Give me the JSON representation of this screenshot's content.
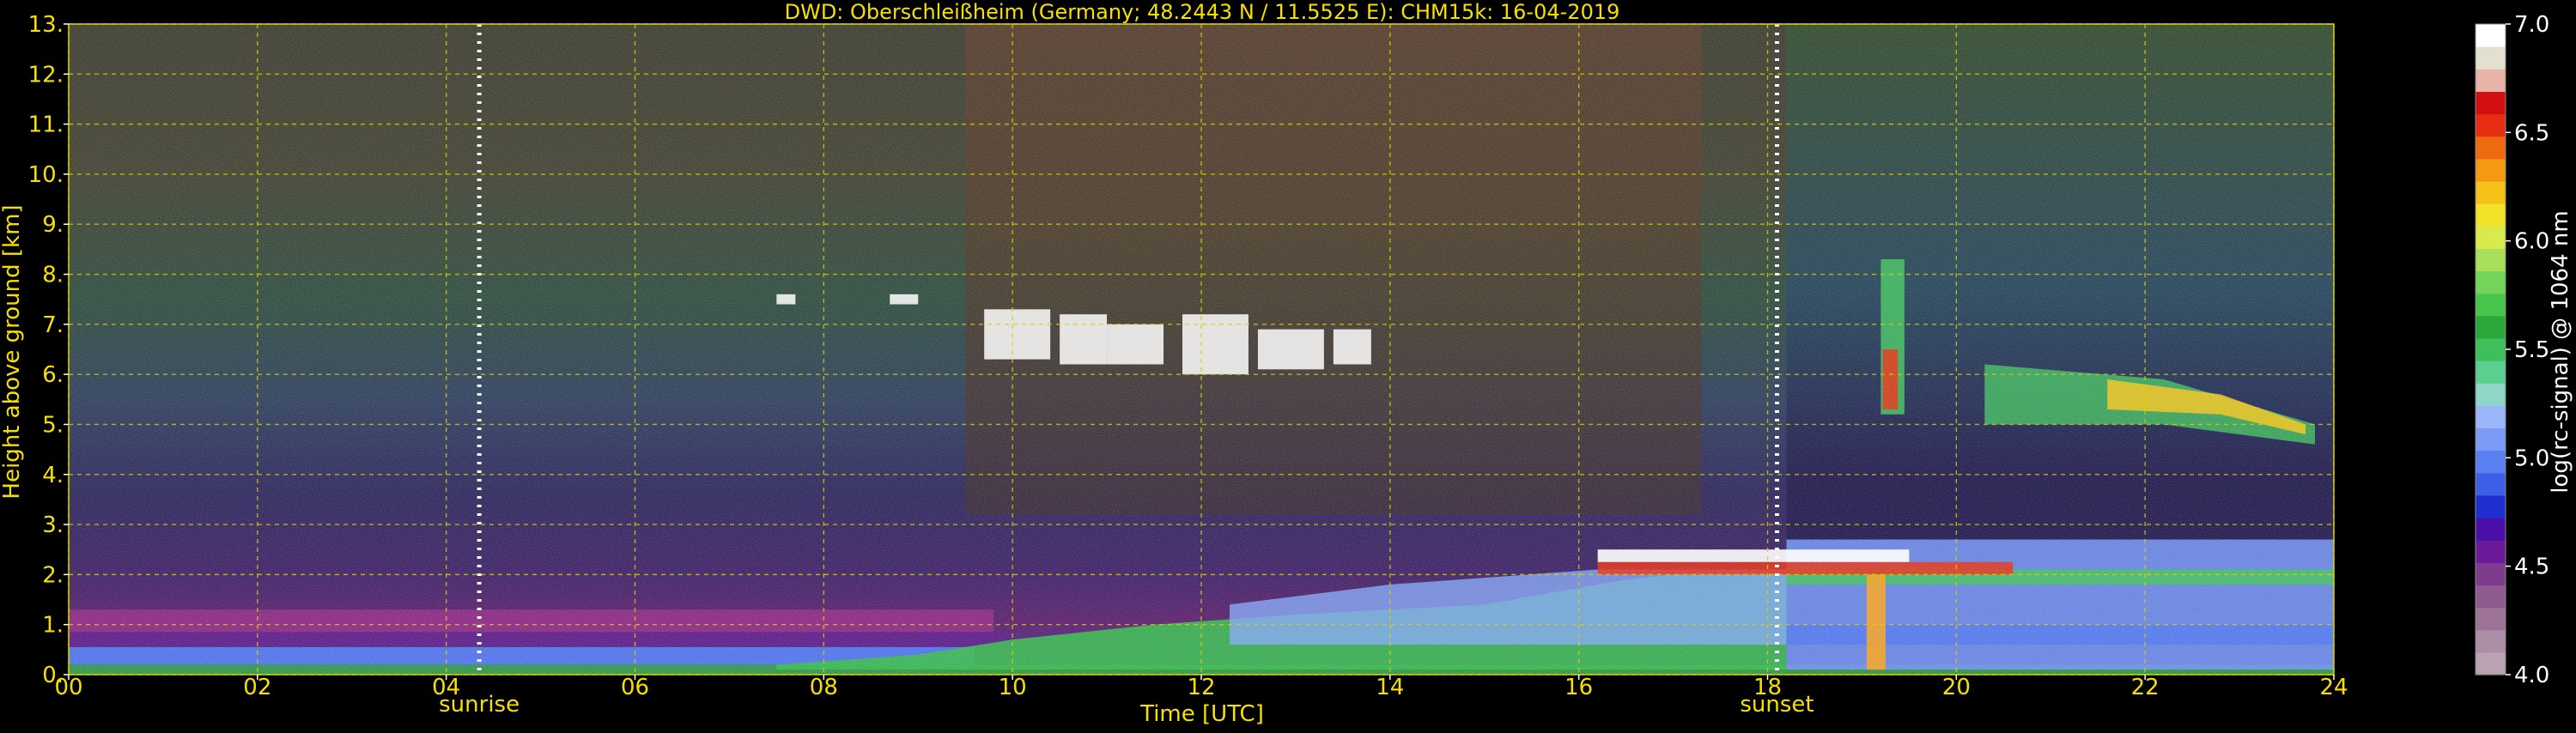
{
  "chart_data": {
    "type": "heatmap",
    "title": "DWD: Oberschleißheim (Germany; 48.2443 N / 11.5525 E):    CHM15k: 16-04-2019",
    "xlabel": "Time [UTC]",
    "ylabel": "Height above ground [km]",
    "xlim": [
      0,
      24
    ],
    "ylim": [
      0,
      13
    ],
    "x_ticks": [
      "00",
      "02",
      "04",
      "06",
      "08",
      "10",
      "12",
      "14",
      "16",
      "18",
      "20",
      "22",
      "24"
    ],
    "y_ticks": [
      "0.",
      "1.",
      "2.",
      "3.",
      "4.",
      "5.",
      "6.",
      "7.",
      "8.",
      "9.",
      "10.",
      "11.",
      "12.",
      "13."
    ],
    "grid": true,
    "markers": [
      {
        "label": "sunrise",
        "time": 4.35
      },
      {
        "label": "sunset",
        "time": 18.1
      }
    ],
    "colorbar": {
      "label": "log(rc-signal) @ 1064 nm",
      "range": [
        4.0,
        7.0
      ],
      "ticks": [
        "4.0",
        "4.5",
        "5.0",
        "5.5",
        "6.0",
        "6.5",
        "7.0"
      ],
      "levels": [
        "#b9a3b3",
        "#ac8fa6",
        "#9d7498",
        "#8f5a90",
        "#7e3c8e",
        "#6a1a98",
        "#4a0fa8",
        "#1e2fd0",
        "#3b5fe6",
        "#5a7ff0",
        "#7b9bf6",
        "#9cb6fb",
        "#8fd6c8",
        "#5bcf8e",
        "#3fbf5c",
        "#2aa83a",
        "#49c44c",
        "#74d45a",
        "#a8e05c",
        "#d8ea4c",
        "#f2e22a",
        "#f6c21a",
        "#f39a12",
        "#ee6a10",
        "#e62e12",
        "#d40f0f",
        "#e8b3a8",
        "#e4e0cf",
        "#ffffff"
      ]
    }
  }
}
